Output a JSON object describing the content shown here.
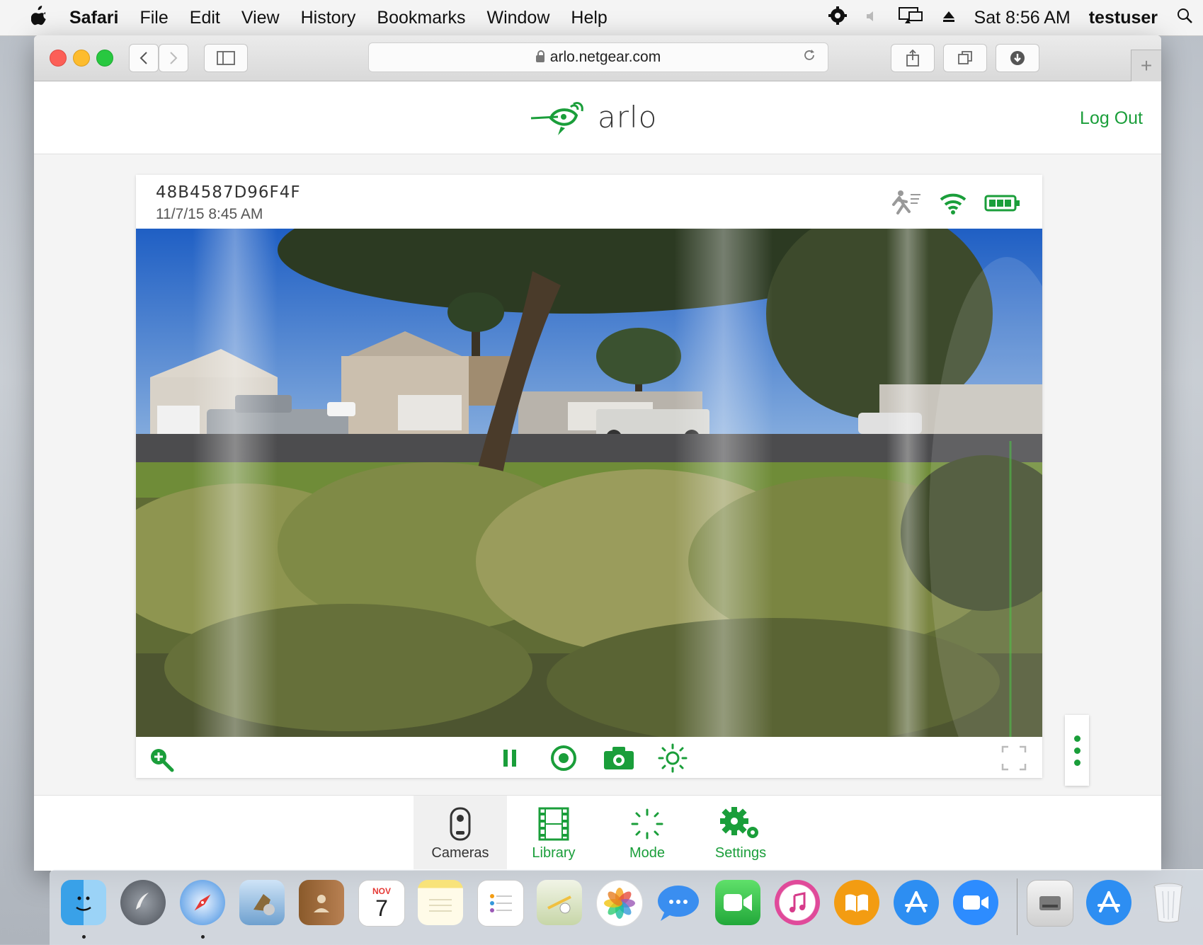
{
  "menubar": {
    "apple": "",
    "app": "Safari",
    "items": [
      "File",
      "Edit",
      "View",
      "History",
      "Bookmarks",
      "Window",
      "Help"
    ],
    "clock": "Sat 8:56 AM",
    "user": "testuser"
  },
  "browser": {
    "url": "arlo.netgear.com",
    "new_tab": "+"
  },
  "arlo": {
    "logo_text": "arlo",
    "logout": "Log Out",
    "camera": {
      "name": "48B4587D96F4F",
      "timestamp": "11/7/15 8:45 AM"
    },
    "nav": [
      {
        "label": "Cameras",
        "icon": "camera-icon",
        "active": true
      },
      {
        "label": "Library",
        "icon": "film-icon",
        "active": false
      },
      {
        "label": "Mode",
        "icon": "mode-icon",
        "active": false
      },
      {
        "label": "Settings",
        "icon": "gear-icon",
        "active": false
      }
    ]
  },
  "dock": {
    "calendar_month": "NOV",
    "calendar_day": "7"
  },
  "colors": {
    "arlo_green": "#1a9e3a",
    "menubar_bg": "#f4f4f4"
  }
}
